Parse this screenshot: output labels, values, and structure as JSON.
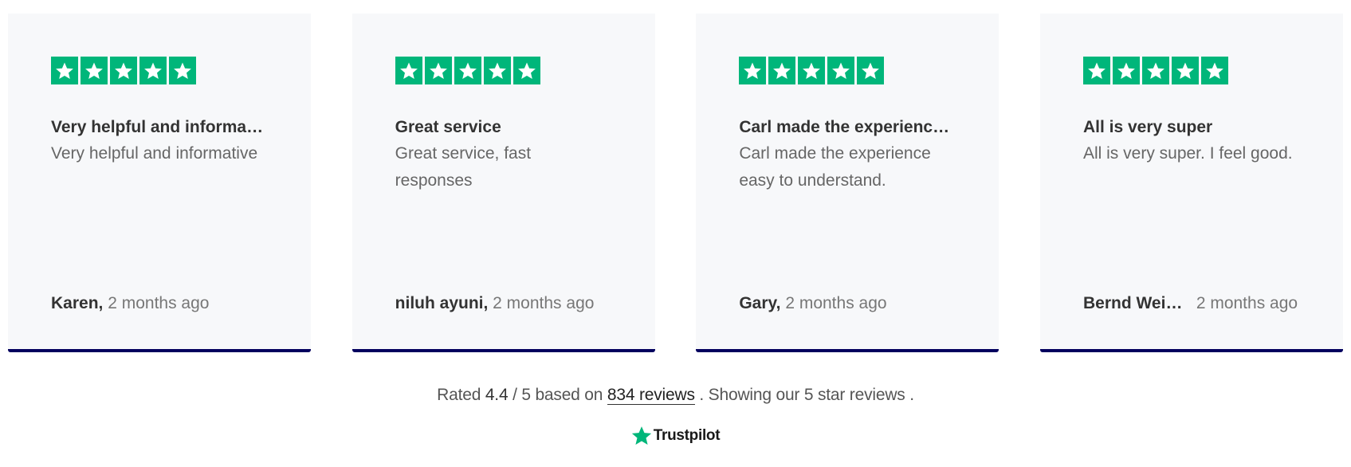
{
  "reviews": [
    {
      "stars": 5,
      "title": "Very helpful and informati…",
      "body": "Very helpful and informative",
      "author": "Karen,",
      "time": "2 months ago"
    },
    {
      "stars": 5,
      "title": "Great service",
      "body": "Great service, fast responses",
      "author": "niluh ayuni,",
      "time": "2 months ago"
    },
    {
      "stars": 5,
      "title": "Carl made the experience …",
      "body": "Carl made the experience easy to understand.",
      "author": "Gary,",
      "time": "2 months ago"
    },
    {
      "stars": 5,
      "title": "All is very super",
      "body": "All is very super. I feel good.",
      "author": "Bernd Weid…",
      "time": "2 months ago"
    }
  ],
  "summary": {
    "prefix": "Rated",
    "rating": "4.4",
    "scale": "/ 5 based on",
    "reviews_link": "834 reviews",
    "suffix": ". Showing our 5 star reviews ."
  },
  "brand": {
    "name": "Trustpilot",
    "icon": "trustpilot-star-icon"
  },
  "colors": {
    "star_green": "#00b67a",
    "card_accent": "#03005e",
    "card_bg": "#f7f8fa"
  }
}
